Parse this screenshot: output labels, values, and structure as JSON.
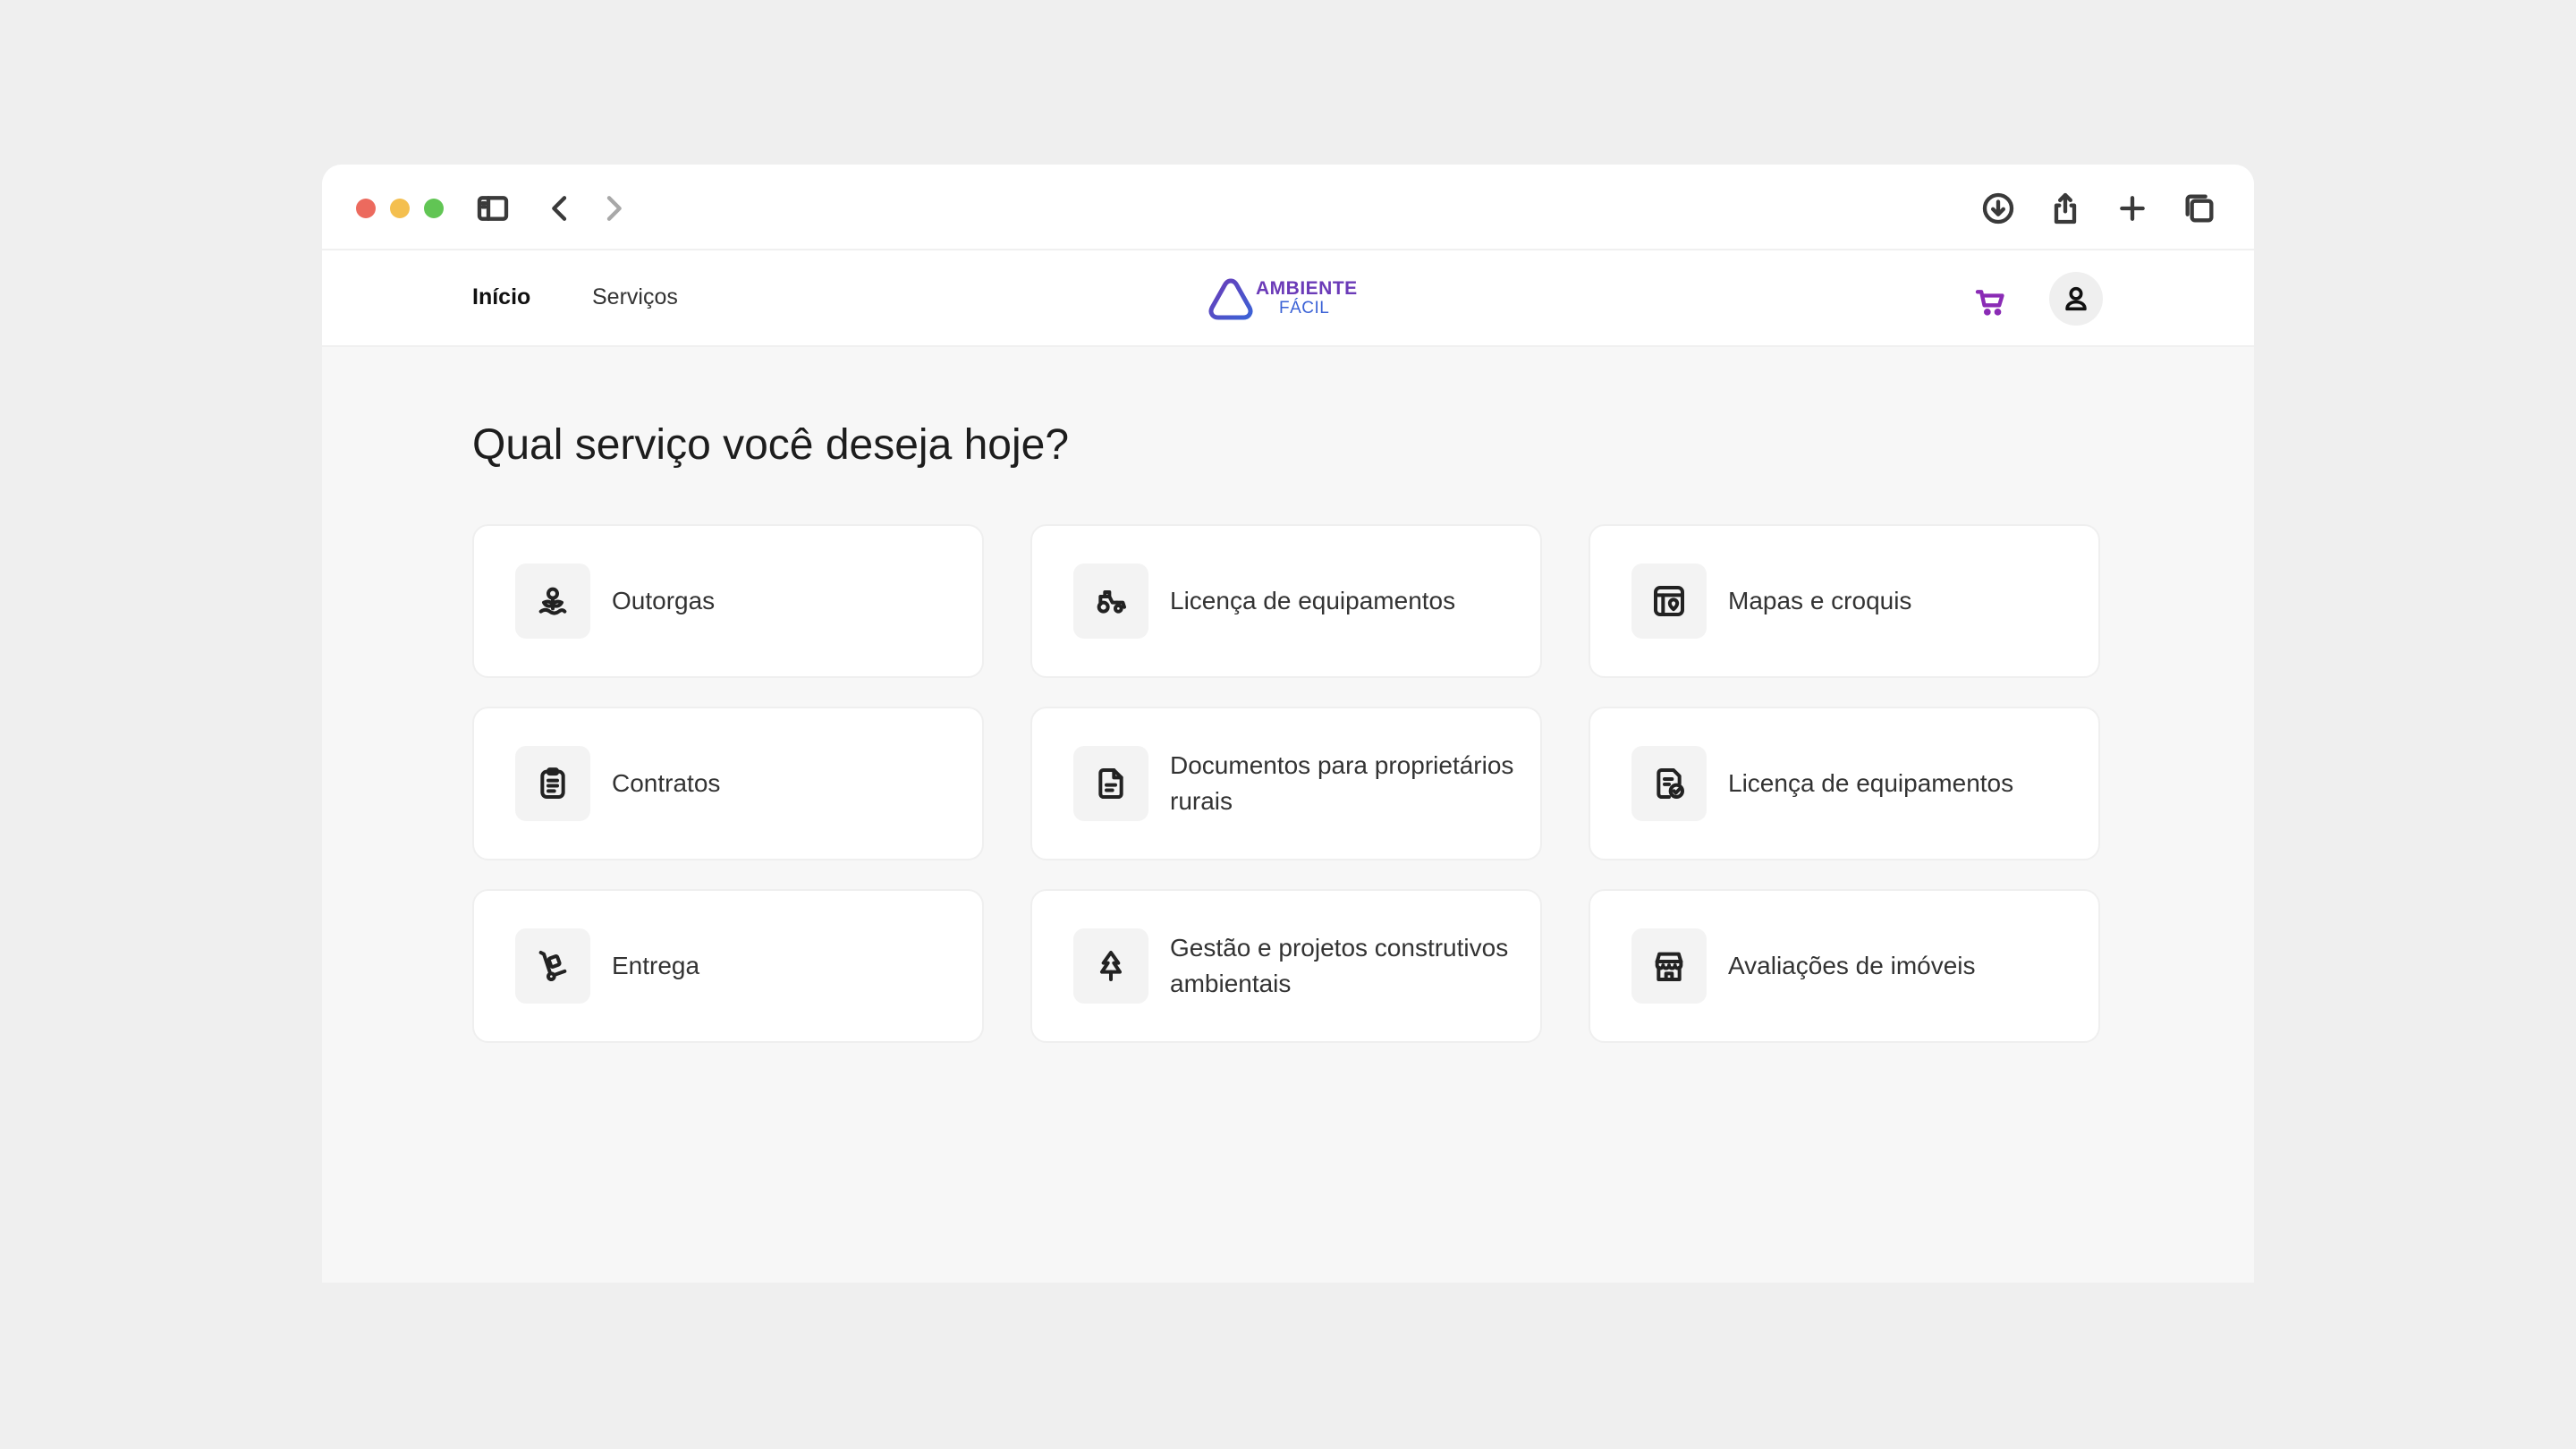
{
  "nav": {
    "links": [
      {
        "label": "Início"
      },
      {
        "label": "Serviços"
      }
    ],
    "logo": {
      "line1": "AMBIENTE",
      "line2": "FÁCIL"
    }
  },
  "main": {
    "heading": "Qual serviço você deseja hoje?",
    "cards": [
      {
        "label": "Outorgas",
        "icon": "plant-icon"
      },
      {
        "label": "Licença de equipamentos",
        "icon": "tractor-icon"
      },
      {
        "label": "Mapas e croquis",
        "icon": "map-pin-icon"
      },
      {
        "label": "Contratos",
        "icon": "clipboard-icon"
      },
      {
        "label": "Documentos para proprietários rurais",
        "icon": "document-icon"
      },
      {
        "label": "Licença de equipamentos",
        "icon": "certificate-check-icon"
      },
      {
        "label": "Entrega",
        "icon": "hand-truck-icon"
      },
      {
        "label": "Gestão e projetos construtivos ambientais",
        "icon": "tree-icon"
      },
      {
        "label": "Avaliações de imóveis",
        "icon": "building-icon"
      }
    ]
  },
  "colors": {
    "accent": "#8a2bb5",
    "logo_purple": "#6b3bb8",
    "logo_blue": "#3b62d6"
  }
}
